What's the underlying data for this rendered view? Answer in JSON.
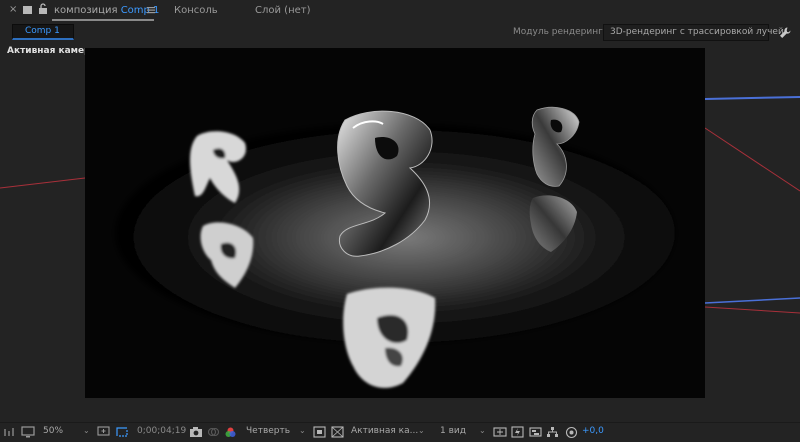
{
  "tabs": {
    "composition_prefix": "композиция",
    "composition_name": "Comp 1",
    "console": "Консоль",
    "layer": "Слой (нет)"
  },
  "options": {
    "comp_chip": "Comp 1",
    "renderer_label": "Модуль рендеринга:",
    "renderer_value": "3D-рендеринг с трассировкой лучей"
  },
  "viewer": {
    "camera_label": "Активная камера"
  },
  "toolbar": {
    "zoom": "50%",
    "timecode": "0;00;04;19",
    "resolution": "Четверть",
    "camera": "Активная ка...",
    "views": "1 вид",
    "exposure": "+0,0"
  },
  "colors": {
    "accent": "#3c9aff",
    "panel_bg": "#232323"
  },
  "icons": [
    "close-icon",
    "composition-icon",
    "lock-icon",
    "panel-menu-icon",
    "wrench-icon",
    "monitor-icon",
    "fit-icon",
    "region-icon",
    "camera-icon",
    "color-wheel-icon",
    "transparency-grid-icon",
    "3d-view-icon",
    "fast-preview-icon",
    "flowchart-icon",
    "reset-exposure-icon"
  ]
}
